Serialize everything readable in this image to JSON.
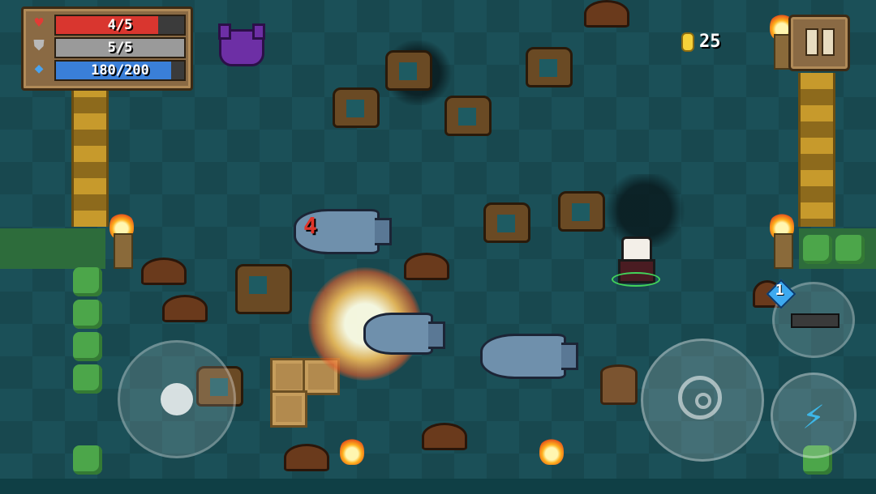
{
  "hud": {
    "health": {
      "text": "4/5",
      "value": 4,
      "max": 5,
      "color": "#d9362f",
      "icon": "heart-icon"
    },
    "armor": {
      "text": "5/5",
      "value": 5,
      "max": 5,
      "color": "#9a9a9a",
      "icon": "shield-icon"
    },
    "energy": {
      "text": "180/200",
      "value": 180,
      "max": 200,
      "color": "#3a7fd8",
      "icon": "energy-diamond-icon"
    }
  },
  "coins": {
    "count": "25",
    "icon": "coin-icon"
  },
  "weapon": {
    "energy_cost": "1",
    "icon": "rifle-icon"
  },
  "damage_number": "4",
  "controls": {
    "pause_icon": "pause-icon",
    "attack_icon": "crosshair-icon",
    "skill_icon": "lightning-bolt-icon",
    "joystick": "movement-joystick"
  }
}
